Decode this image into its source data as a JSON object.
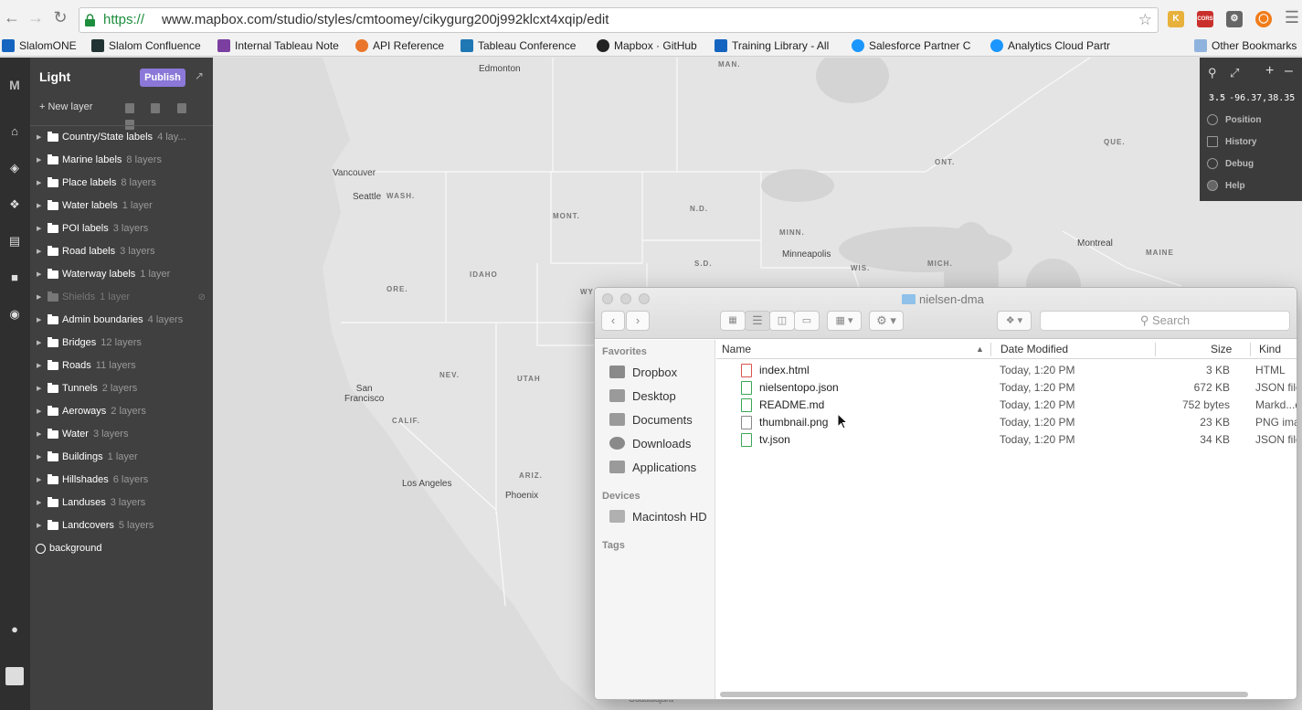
{
  "browser": {
    "url_scheme": "https://",
    "url_path": "www.mapbox.com/studio/styles/cmtoomey/cikygurg200j992klcxt4xqip/edit",
    "bookmarks": [
      {
        "label": "SlalomONE"
      },
      {
        "label": "Slalom Confluence"
      },
      {
        "label": "Internal Tableau Note"
      },
      {
        "label": "API Reference"
      },
      {
        "label": "Tableau Conference"
      },
      {
        "label": "Mapbox · GitHub"
      },
      {
        "label": "Training Library - All"
      },
      {
        "label": "Salesforce Partner C"
      },
      {
        "label": "Analytics Cloud Partr"
      },
      {
        "label": "Other Bookmarks"
      }
    ],
    "extension_badge": "CORS"
  },
  "studio": {
    "logo": "M",
    "style_name": "Light",
    "publish_label": "Publish",
    "new_layer_label": "New layer",
    "layers": [
      {
        "name": "Country/State labels",
        "count": "4 lay..."
      },
      {
        "name": "Marine labels",
        "count": "8 layers"
      },
      {
        "name": "Place labels",
        "count": "8 layers"
      },
      {
        "name": "Water labels",
        "count": "1 layer"
      },
      {
        "name": "POI labels",
        "count": "3 layers"
      },
      {
        "name": "Road labels",
        "count": "3 layers"
      },
      {
        "name": "Waterway labels",
        "count": "1 layer"
      },
      {
        "name": "Shields",
        "count": "1 layer"
      },
      {
        "name": "Admin boundaries",
        "count": "4 layers"
      },
      {
        "name": "Bridges",
        "count": "12 layers"
      },
      {
        "name": "Roads",
        "count": "11 layers"
      },
      {
        "name": "Tunnels",
        "count": "2 layers"
      },
      {
        "name": "Aeroways",
        "count": "2 layers"
      },
      {
        "name": "Water",
        "count": "3 layers"
      },
      {
        "name": "Buildings",
        "count": "1 layer"
      },
      {
        "name": "Hillshades",
        "count": "6 layers"
      },
      {
        "name": "Landuses",
        "count": "3 layers"
      },
      {
        "name": "Landcovers",
        "count": "5 layers"
      }
    ],
    "background_layer": "background"
  },
  "map": {
    "zoom": "3.5",
    "center": "-96.37,38.35",
    "controls": [
      "Position",
      "History",
      "Debug",
      "Help"
    ],
    "labels": {
      "edmonton": "Edmonton",
      "vancouver": "Vancouver",
      "seattle": "Seattle",
      "wash": "WASH.",
      "mont": "MONT.",
      "nd": "N.D.",
      "minn": "MINN.",
      "minneapolis": "Minneapolis",
      "sd": "S.D.",
      "wis": "WIS.",
      "mich": "MICH.",
      "idaho": "IDAHO",
      "ore": "ORE.",
      "wy": "WY",
      "nev": "NEV.",
      "utah": "UTAH",
      "sanfrancisco": "San\nFrancisco",
      "calif": "CALIF.",
      "arizona": "ARIZ.",
      "phoenix": "Phoenix",
      "losangeles": "Los Angeles",
      "man": "MAN.",
      "ont": "ONT.",
      "que": "QUE.",
      "montreal": "Montreal",
      "maine": "MAINE",
      "guadalajara": "Guadalajara"
    }
  },
  "finder": {
    "title": "nielsen-dma",
    "search_placeholder": "Search",
    "favorites_heading": "Favorites",
    "favorites": [
      "Dropbox",
      "Desktop",
      "Documents",
      "Downloads",
      "Applications"
    ],
    "devices_heading": "Devices",
    "devices": [
      "Macintosh HD"
    ],
    "tags_heading": "Tags",
    "columns": {
      "name": "Name",
      "date": "Date Modified",
      "size": "Size",
      "kind": "Kind"
    },
    "files": [
      {
        "name": "index.html",
        "date": "Today, 1:20 PM",
        "size": "3 KB",
        "kind": "HTML"
      },
      {
        "name": "nielsentopo.json",
        "date": "Today, 1:20 PM",
        "size": "672 KB",
        "kind": "JSON file"
      },
      {
        "name": "README.md",
        "date": "Today, 1:20 PM",
        "size": "752 bytes",
        "kind": "Markd...d"
      },
      {
        "name": "thumbnail.png",
        "date": "Today, 1:20 PM",
        "size": "23 KB",
        "kind": "PNG ima"
      },
      {
        "name": "tv.json",
        "date": "Today, 1:20 PM",
        "size": "34 KB",
        "kind": "JSON file"
      }
    ]
  }
}
